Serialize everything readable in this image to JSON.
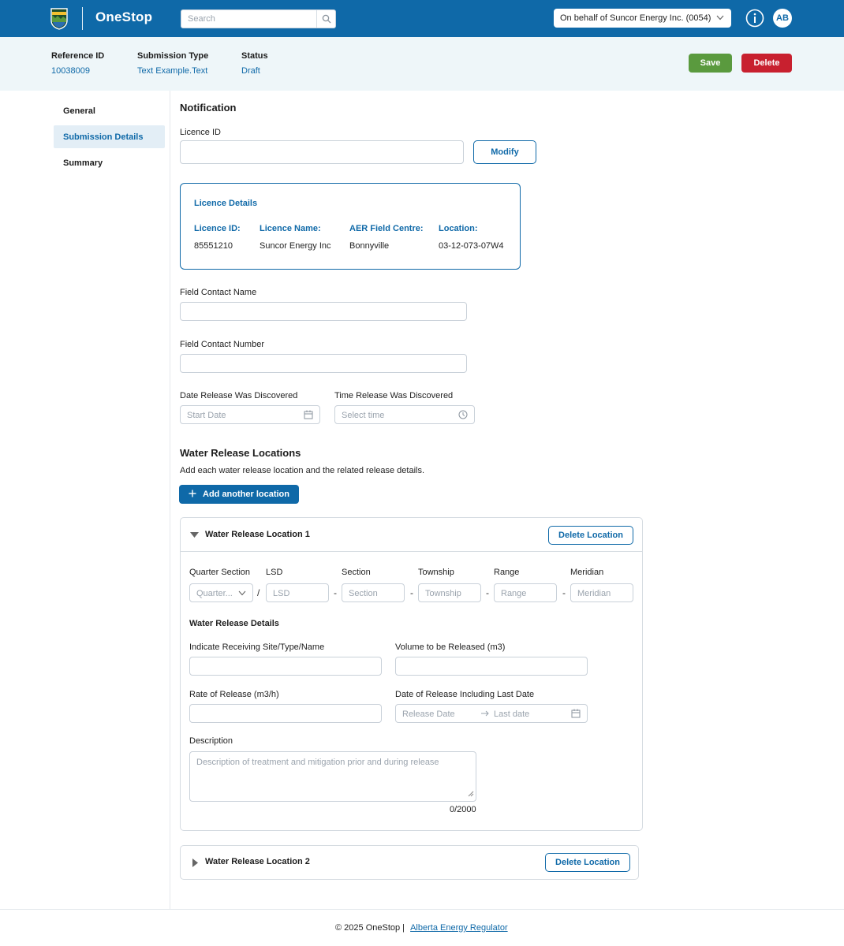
{
  "header": {
    "brand": "OneStop",
    "search_placeholder": "Search",
    "behalf": "On behalf of Suncor Energy Inc. (0054)",
    "avatar": "AB",
    "colors": {
      "bar": "#0f69a8",
      "save": "#5a9a3e",
      "delete": "#c8202f"
    }
  },
  "submission": {
    "ref_label": "Reference ID",
    "ref_value": "10038009",
    "type_label": "Submission Type",
    "type_value": "Text Example.Text",
    "status_label": "Status",
    "status_value": "Draft",
    "save": "Save",
    "delete": "Delete"
  },
  "nav": {
    "items": [
      "General",
      "Submission Details",
      "Summary"
    ],
    "active": "Submission Details"
  },
  "form": {
    "section_title": "Notification",
    "licence_id_label": "Licence ID",
    "modify": "Modify",
    "licence_details": {
      "title": "Licence Details",
      "id_label": "Licence ID:",
      "id_value": "85551210",
      "name_label": "Licence Name:",
      "name_value": "Suncor Energy Inc",
      "centre_label": "AER Field Centre:",
      "centre_value": "Bonnyville",
      "location_label": "Location:",
      "location_value": "03-12-073-07W4"
    },
    "contact_name_label": "Field Contact Name",
    "contact_number_label": "Field Contact Number",
    "date_label": "Date Release Was Discovered",
    "date_placeholder": "Start Date",
    "time_label": "Time Release Was Discovered",
    "time_placeholder": "Select time"
  },
  "locations": {
    "title": "Water Release Locations",
    "subtitle": "Add each water release location and the related release details.",
    "add_button": "Add another location",
    "delete_location": "Delete Location",
    "loc1_title": "Water Release Location 1",
    "loc2_title": "Water Release Location 2",
    "legal": {
      "quarter_label": "Quarter Section",
      "quarter_placeholder": "Quarter...",
      "lsd_label": "LSD",
      "lsd_placeholder": "LSD",
      "section_label": "Section",
      "section_placeholder": "Section",
      "township_label": "Township",
      "township_placeholder": "Township",
      "range_label": "Range",
      "range_placeholder": "Range",
      "meridian_label": "Meridian",
      "meridian_placeholder": "Meridian"
    },
    "details_title": "Water Release Details",
    "receiving_label": "Indicate Receiving Site/Type/Name",
    "volume_label": "Volume to be Released (m3)",
    "rate_label": "Rate of Release (m3/h)",
    "release_date_label": "Date of Release Including Last Date",
    "release_date_placeholder": "Release Date",
    "last_date_placeholder": "Last date",
    "description_label": "Description",
    "description_placeholder": "Description of treatment and mitigation prior and during release",
    "char_count": "0/2000"
  },
  "footer": {
    "copyright": "© 2025 OneStop |",
    "link": "Alberta Energy Regulator"
  }
}
